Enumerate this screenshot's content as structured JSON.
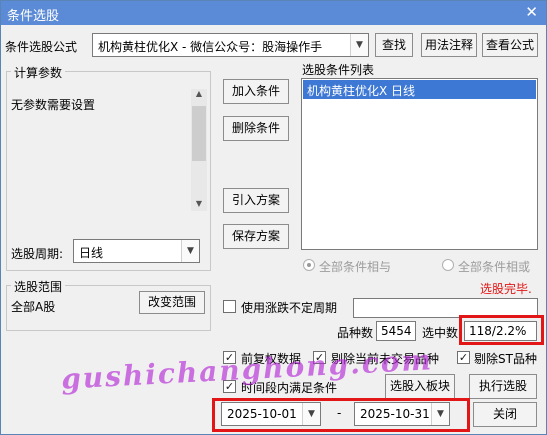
{
  "window": {
    "title": "条件选股",
    "close_icon": "close-icon"
  },
  "formula": {
    "label": "条件选股公式",
    "value": "机构黄柱优化X  -  微信公众号：股海操作手"
  },
  "buttons": {
    "find": "查找",
    "usage": "用法注释",
    "view": "查看公式",
    "add": "加入条件",
    "delete": "删除条件",
    "import": "引入方案",
    "save": "保存方案",
    "change_range": "改变范围",
    "to_block": "选股入板块",
    "execute": "执行选股",
    "close": "关闭"
  },
  "params": {
    "group_label": "计算参数",
    "text": "无参数需要设置",
    "period_label": "选股周期:",
    "period_value": "日线"
  },
  "conditions": {
    "group_label": "选股条件列表",
    "items": [
      "机构黄柱优化X  日线"
    ]
  },
  "logic": {
    "and_label": "全部条件相与",
    "or_label": "全部条件相或"
  },
  "status": {
    "done": "选股完毕.",
    "done_color": "#e21616"
  },
  "range": {
    "group_label": "选股范围",
    "value": "全部A股"
  },
  "options": {
    "unfixed_period": "使用涨跌不定周期",
    "forward_adjust": "前复权数据",
    "exclude_untraded": "剔除当前未交易品种",
    "exclude_st": "剔除ST品种",
    "time_range": "时间段内满足条件"
  },
  "stats": {
    "count_label": "品种数",
    "count_value": "5454",
    "selected_label": "选中数",
    "selected_value": "118/2.2%"
  },
  "dates": {
    "start": "2025-10-01",
    "separator": "-",
    "end": "2025-10-31"
  },
  "watermark": "gushichanghong.com"
}
